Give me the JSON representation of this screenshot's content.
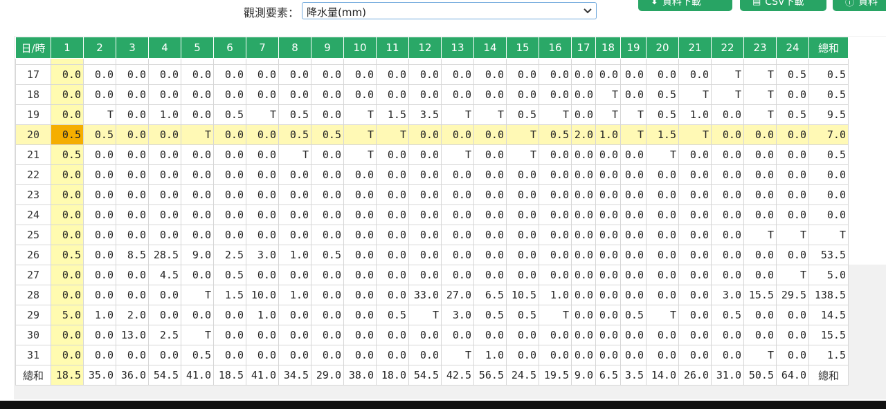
{
  "toolbar": {
    "observe_label": "觀測要素：",
    "observe_value": "降水量(mm)",
    "btn_data_download": "資料下載",
    "btn_csv_download": "CSV下載",
    "btn_more": "資料"
  },
  "table": {
    "headers": [
      "日/時",
      "1",
      "2",
      "3",
      "4",
      "5",
      "6",
      "7",
      "8",
      "9",
      "10",
      "11",
      "12",
      "13",
      "14",
      "15",
      "16",
      "17",
      "18",
      "19",
      "20",
      "21",
      "22",
      "23",
      "24",
      "總和"
    ],
    "highlight_day": "20",
    "rows": [
      [
        "17",
        "0.0",
        "0.0",
        "0.0",
        "0.0",
        "0.0",
        "0.0",
        "0.0",
        "0.0",
        "0.0",
        "0.0",
        "0.0",
        "0.0",
        "0.0",
        "0.0",
        "0.0",
        "0.0",
        "0.0",
        "0.0",
        "0.0",
        "0.0",
        "0.0",
        "T",
        "T",
        "0.5",
        "0.5"
      ],
      [
        "18",
        "0.0",
        "0.0",
        "0.0",
        "0.0",
        "0.0",
        "0.0",
        "0.0",
        "0.0",
        "0.0",
        "0.0",
        "0.0",
        "0.0",
        "0.0",
        "0.0",
        "0.0",
        "0.0",
        "0.0",
        "T",
        "0.0",
        "0.5",
        "T",
        "T",
        "T",
        "0.0",
        "0.5"
      ],
      [
        "19",
        "0.0",
        "T",
        "0.0",
        "1.0",
        "0.0",
        "0.5",
        "T",
        "0.5",
        "0.0",
        "T",
        "1.5",
        "3.5",
        "T",
        "T",
        "0.5",
        "T",
        "0.0",
        "T",
        "T",
        "0.5",
        "1.0",
        "0.0",
        "T",
        "0.5",
        "9.5"
      ],
      [
        "20",
        "0.5",
        "0.5",
        "0.0",
        "0.0",
        "T",
        "0.0",
        "0.0",
        "0.5",
        "0.5",
        "T",
        "T",
        "0.0",
        "0.0",
        "0.0",
        "T",
        "0.5",
        "2.0",
        "1.0",
        "T",
        "1.5",
        "T",
        "0.0",
        "0.0",
        "0.0",
        "7.0"
      ],
      [
        "21",
        "0.5",
        "0.0",
        "0.0",
        "0.0",
        "0.0",
        "0.0",
        "0.0",
        "T",
        "0.0",
        "T",
        "0.0",
        "0.0",
        "T",
        "0.0",
        "T",
        "0.0",
        "0.0",
        "0.0",
        "0.0",
        "T",
        "0.0",
        "0.0",
        "0.0",
        "0.0",
        "0.5"
      ],
      [
        "22",
        "0.0",
        "0.0",
        "0.0",
        "0.0",
        "0.0",
        "0.0",
        "0.0",
        "0.0",
        "0.0",
        "0.0",
        "0.0",
        "0.0",
        "0.0",
        "0.0",
        "0.0",
        "0.0",
        "0.0",
        "0.0",
        "0.0",
        "0.0",
        "0.0",
        "0.0",
        "0.0",
        "0.0",
        "0.0"
      ],
      [
        "23",
        "0.0",
        "0.0",
        "0.0",
        "0.0",
        "0.0",
        "0.0",
        "0.0",
        "0.0",
        "0.0",
        "0.0",
        "0.0",
        "0.0",
        "0.0",
        "0.0",
        "0.0",
        "0.0",
        "0.0",
        "0.0",
        "0.0",
        "0.0",
        "0.0",
        "0.0",
        "0.0",
        "0.0",
        "0.0"
      ],
      [
        "24",
        "0.0",
        "0.0",
        "0.0",
        "0.0",
        "0.0",
        "0.0",
        "0.0",
        "0.0",
        "0.0",
        "0.0",
        "0.0",
        "0.0",
        "0.0",
        "0.0",
        "0.0",
        "0.0",
        "0.0",
        "0.0",
        "0.0",
        "0.0",
        "0.0",
        "0.0",
        "0.0",
        "0.0",
        "0.0"
      ],
      [
        "25",
        "0.0",
        "0.0",
        "0.0",
        "0.0",
        "0.0",
        "0.0",
        "0.0",
        "0.0",
        "0.0",
        "0.0",
        "0.0",
        "0.0",
        "0.0",
        "0.0",
        "0.0",
        "0.0",
        "0.0",
        "0.0",
        "0.0",
        "0.0",
        "0.0",
        "0.0",
        "T",
        "T",
        "T"
      ],
      [
        "26",
        "0.5",
        "0.0",
        "8.5",
        "28.5",
        "9.0",
        "2.5",
        "3.0",
        "1.0",
        "0.5",
        "0.0",
        "0.0",
        "0.0",
        "0.0",
        "0.0",
        "0.0",
        "0.0",
        "0.0",
        "0.0",
        "0.0",
        "0.0",
        "0.0",
        "0.0",
        "0.0",
        "0.0",
        "53.5"
      ],
      [
        "27",
        "0.0",
        "0.0",
        "0.0",
        "4.5",
        "0.0",
        "0.5",
        "0.0",
        "0.0",
        "0.0",
        "0.0",
        "0.0",
        "0.0",
        "0.0",
        "0.0",
        "0.0",
        "0.0",
        "0.0",
        "0.0",
        "0.0",
        "0.0",
        "0.0",
        "0.0",
        "0.0",
        "T",
        "5.0"
      ],
      [
        "28",
        "0.0",
        "0.0",
        "0.0",
        "0.0",
        "T",
        "1.5",
        "10.0",
        "1.0",
        "0.0",
        "0.0",
        "0.0",
        "33.0",
        "27.0",
        "6.5",
        "10.5",
        "1.0",
        "0.0",
        "0.0",
        "0.0",
        "0.0",
        "0.0",
        "3.0",
        "15.5",
        "29.5",
        "138.5"
      ],
      [
        "29",
        "5.0",
        "1.0",
        "2.0",
        "0.0",
        "0.0",
        "0.0",
        "1.0",
        "0.0",
        "0.0",
        "0.0",
        "0.5",
        "T",
        "3.0",
        "0.5",
        "0.5",
        "T",
        "0.0",
        "0.0",
        "0.5",
        "T",
        "0.0",
        "0.5",
        "0.0",
        "0.0",
        "14.5"
      ],
      [
        "30",
        "0.0",
        "0.0",
        "13.0",
        "2.5",
        "T",
        "0.0",
        "0.0",
        "0.0",
        "0.0",
        "0.0",
        "0.0",
        "0.0",
        "0.0",
        "0.0",
        "0.0",
        "0.0",
        "0.0",
        "0.0",
        "0.0",
        "0.0",
        "0.0",
        "0.0",
        "0.0",
        "0.0",
        "15.5"
      ],
      [
        "31",
        "0.0",
        "0.0",
        "0.0",
        "0.0",
        "0.5",
        "0.0",
        "0.0",
        "0.0",
        "0.0",
        "0.0",
        "0.0",
        "0.0",
        "T",
        "1.0",
        "0.0",
        "0.0",
        "0.0",
        "0.0",
        "0.0",
        "0.0",
        "0.0",
        "0.0",
        "T",
        "0.0",
        "1.5"
      ]
    ],
    "sum_row": [
      "總和",
      "18.5",
      "35.0",
      "36.0",
      "54.5",
      "41.0",
      "18.5",
      "41.0",
      "34.5",
      "29.0",
      "38.0",
      "18.0",
      "54.5",
      "42.5",
      "56.5",
      "24.5",
      "19.5",
      "9.0",
      "6.5",
      "3.5",
      "14.0",
      "26.0",
      "31.0",
      "50.5",
      "64.0",
      "總和"
    ]
  },
  "colors": {
    "header_green": "#2aa867",
    "highlight_row": "#fff9b5",
    "selected_cell": "#f5ae00",
    "column_highlight": "#fffbb0"
  }
}
